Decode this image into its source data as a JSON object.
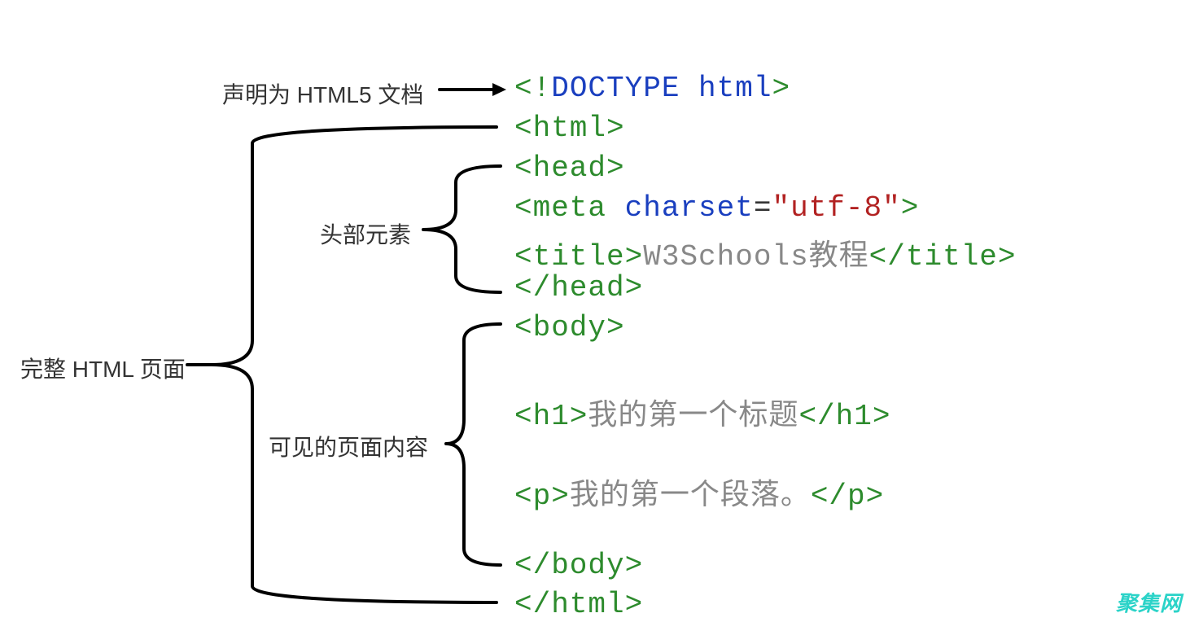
{
  "labels": {
    "doctype": "声明为 HTML5 文档",
    "full_page": "完整 HTML 页面",
    "head": "头部元素",
    "body": "可见的页面内容"
  },
  "code": {
    "line1": {
      "bang": "<!",
      "word": "DOCTYPE html",
      "close": ">"
    },
    "line2": {
      "open": "<html>"
    },
    "line3": {
      "open": "<head>"
    },
    "line4": {
      "open": "<meta ",
      "attr": "charset",
      "eq": "=",
      "val": "\"utf-8\"",
      "close": ">"
    },
    "line5": {
      "open": "<title>",
      "text": "W3Schools教程",
      "close": "</title>"
    },
    "line6": {
      "open": "</head>"
    },
    "line7": {
      "open": "<body>"
    },
    "line8": {
      "open": "<h1>",
      "text": "我的第一个标题",
      "close": "</h1>"
    },
    "line9": {
      "open": "<p>",
      "text": "我的第一个段落。",
      "close": "</p>"
    },
    "line10": {
      "open": "</body>"
    },
    "line11": {
      "open": "</html>"
    }
  },
  "watermark": "聚集网"
}
